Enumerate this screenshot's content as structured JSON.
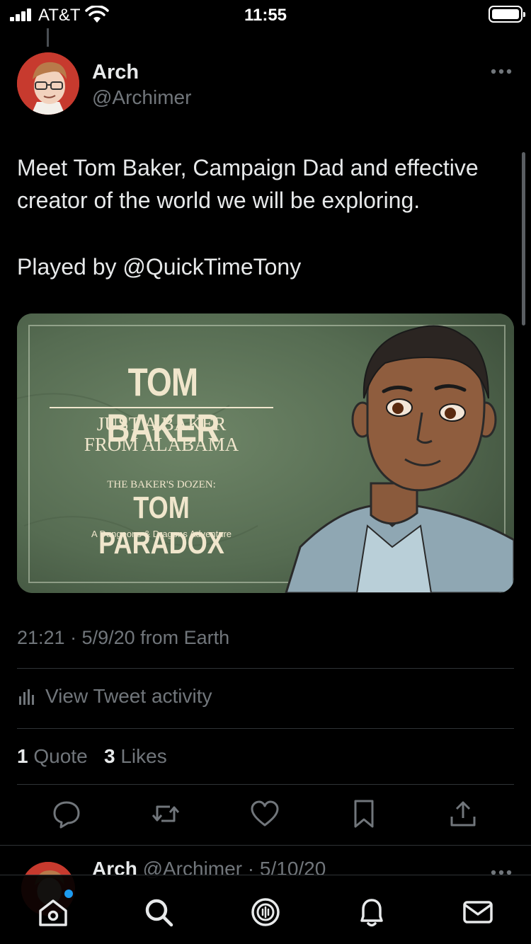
{
  "status_bar": {
    "carrier": "AT&T",
    "time": "11:55"
  },
  "tweet": {
    "author_name": "Arch",
    "author_handle": "@Archimer",
    "text_line_1": "Meet Tom Baker, Campaign Dad and effective creator of the world we will be exploring.",
    "text_line_2": "Played by @QuickTimeTony",
    "timestamp": "21:21 · 5/9/20 from Earth",
    "activity_label": "View Tweet activity",
    "quote_count": "1",
    "quote_label": "Quote",
    "likes_count": "3",
    "likes_label": "Likes"
  },
  "media": {
    "title": "TOM BAKER",
    "subtitle_line_1": "JUST A BAKER",
    "subtitle_line_2": "FROM ALABAMA",
    "series_label": "THE BAKER'S DOZEN:",
    "series_title": "TOM PARADOX",
    "tagline": "A Dungeons & Dragons Adventure"
  },
  "next_tweet": {
    "author_name": "Arch",
    "author_handle": "@Archimer",
    "date": "· 5/10/20"
  },
  "tab_bar": {
    "items": [
      "home-icon",
      "search-icon",
      "spaces-icon",
      "notifications-icon",
      "messages-icon"
    ],
    "home_has_notification": true
  },
  "colors": {
    "background": "#000000",
    "text_primary": "#e7e9ea",
    "text_secondary": "#71767b",
    "divider": "#2f3336",
    "accent": "#1d9bf0",
    "media_green": "#5d7358"
  }
}
